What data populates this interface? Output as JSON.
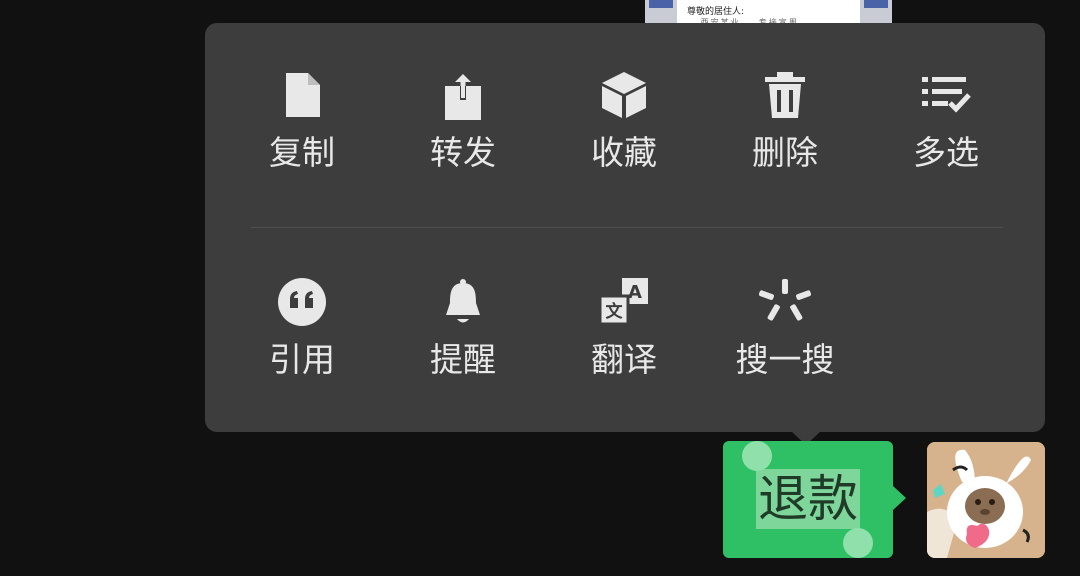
{
  "background_message": {
    "title_text": "尊敬的居住人:",
    "partial_text": "...西安某业 ...专接宣周..."
  },
  "menu": {
    "row1": [
      {
        "id": "copy",
        "label": "复制",
        "icon": "document-icon"
      },
      {
        "id": "forward",
        "label": "转发",
        "icon": "share-icon"
      },
      {
        "id": "favorite",
        "label": "收藏",
        "icon": "cube-icon"
      },
      {
        "id": "delete",
        "label": "删除",
        "icon": "trash-icon"
      },
      {
        "id": "multiselect",
        "label": "多选",
        "icon": "checklist-icon"
      }
    ],
    "row2": [
      {
        "id": "quote",
        "label": "引用",
        "icon": "quote-icon"
      },
      {
        "id": "remind",
        "label": "提醒",
        "icon": "bell-icon"
      },
      {
        "id": "translate",
        "label": "翻译",
        "icon": "translate-icon"
      },
      {
        "id": "search",
        "label": "搜一搜",
        "icon": "sparkle-icon"
      }
    ]
  },
  "message": {
    "text": "退款",
    "bubble_color": "#2fc065",
    "selection_color": "#7ed69b"
  },
  "colors": {
    "background": "#111111",
    "menu_background": "#3d3d3d",
    "menu_text": "#e8e8e8",
    "icon": "#e8e8e8"
  }
}
